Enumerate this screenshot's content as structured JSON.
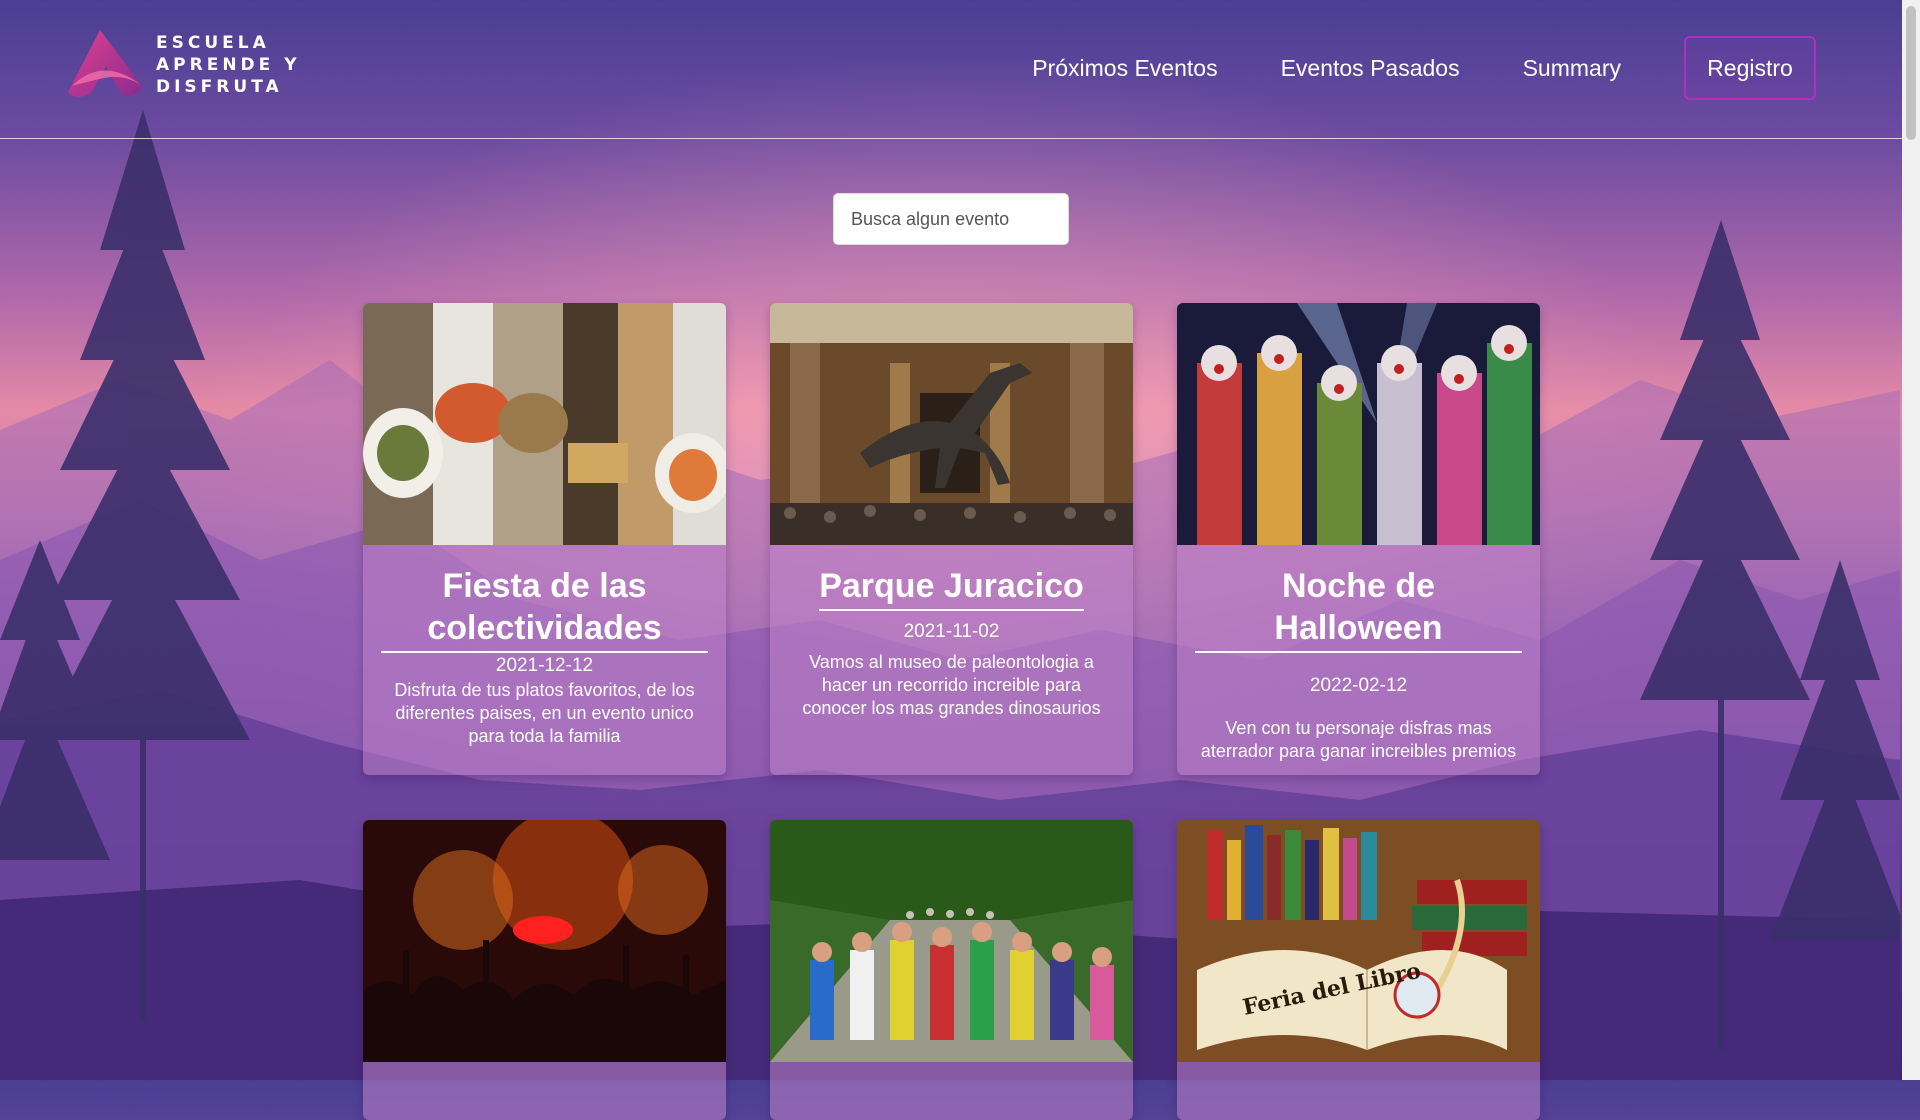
{
  "brand": {
    "line1": "ESCUELA",
    "line2": "APRENDE Y",
    "line3": "DISFRUTA",
    "logo_icon": "triangle-ribbon-logo",
    "accent": "#c2348f"
  },
  "nav": {
    "upcoming": "Próximos Eventos",
    "past": "Eventos Pasados",
    "summary": "Summary",
    "register": "Registro"
  },
  "search": {
    "placeholder": "Busca algun evento",
    "value": ""
  },
  "events": [
    {
      "title": "Fiesta de las colectividades",
      "date": "2021-12-12",
      "description": "Disfruta de tus platos favoritos, de los diferentes paises, en un evento unico para toda la familia",
      "image": "food-collage"
    },
    {
      "title": "Parque Juracico",
      "date": "2021-11-02",
      "description": "Vamos al museo de paleontologia a hacer un recorrido increible para conocer los mas grandes dinosaurios",
      "image": "dinosaur-museum"
    },
    {
      "title": "Noche de Halloween",
      "date": "2022-02-12",
      "description": "Ven con tu personaje disfras mas aterrador para ganar increibles premios",
      "image": "halloween-clowns"
    },
    {
      "image": "concert-crowd"
    },
    {
      "image": "marathon-runners"
    },
    {
      "image": "book-fair",
      "image_text": "Feria del Libro"
    }
  ]
}
